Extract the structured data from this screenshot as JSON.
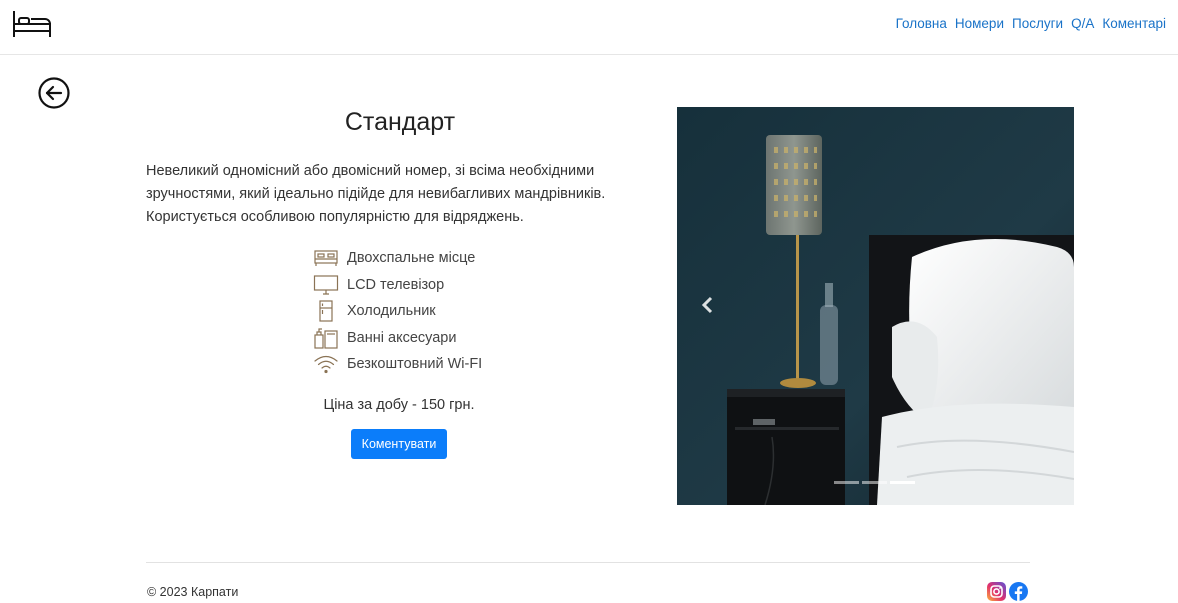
{
  "nav": {
    "logo_icon": "bed-icon",
    "links": [
      "Головна",
      "Номери",
      "Послуги",
      "Q/A",
      "Коментарі"
    ],
    "link_color": "#1a73c8"
  },
  "back_icon": "arrow-left-circle-icon",
  "room": {
    "title": "Стандарт",
    "description": "Невеликий одномісний або двомісний номер, зі всіма необхідними зручностями, який ідеально підійде для невибагливих мандрівників. Користується особливою популярністю для відряджень.",
    "amenities": [
      {
        "icon": "double-bed-icon",
        "label": "Двохспальне місце"
      },
      {
        "icon": "tv-icon",
        "label": "LCD телевізор"
      },
      {
        "icon": "fridge-icon",
        "label": "Холодильник"
      },
      {
        "icon": "bath-accessories-icon",
        "label": "Ванні аксесуари"
      },
      {
        "icon": "wifi-icon",
        "label": "Безкоштовний Wi-FI"
      }
    ],
    "price": "Ціна за добу - 150 грн.",
    "comment_button": "Коментувати",
    "button_color": "#0b7dfa"
  },
  "carousel": {
    "prev_icon": "chevron-left-icon",
    "slide_count": 3,
    "active_slide": 3
  },
  "footer": {
    "copyright": "© 2023 Карпати",
    "social_icons": [
      "instagram-icon",
      "facebook-icon"
    ]
  }
}
